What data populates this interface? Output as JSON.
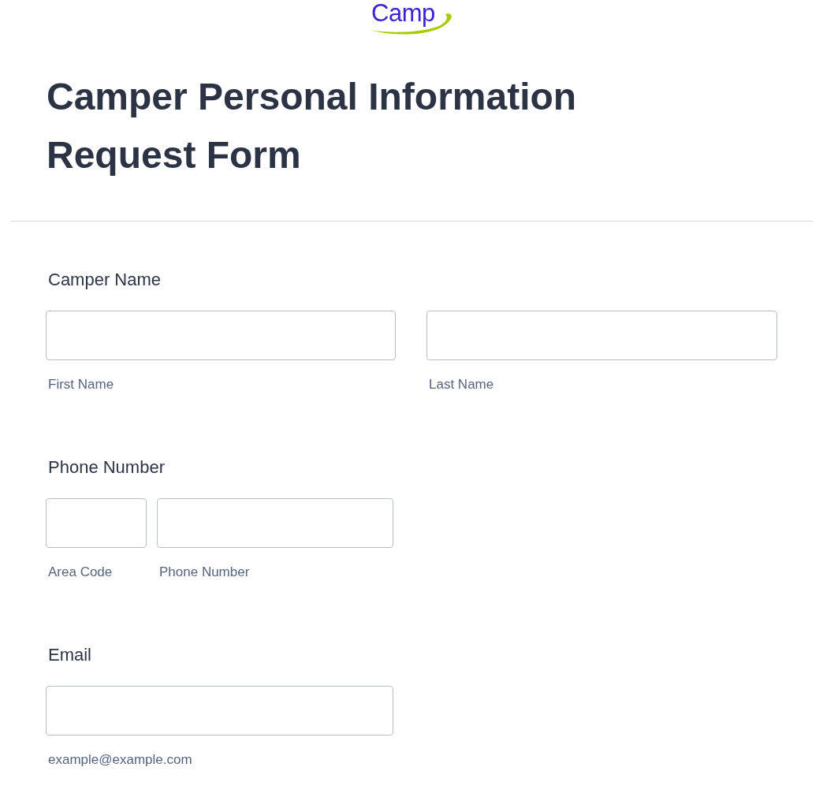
{
  "logo": {
    "text": "Camp"
  },
  "title": "Camper Personal Information Request Form",
  "fields": [
    {
      "kind": "name",
      "label": "Camper Name",
      "inputs": [
        {
          "sublabel": "First Name"
        },
        {
          "sublabel": "Last Name"
        }
      ]
    },
    {
      "kind": "phone",
      "label": "Phone Number",
      "inputs": [
        {
          "sublabel": "Area Code"
        },
        {
          "sublabel": "Phone Number"
        }
      ]
    },
    {
      "kind": "email",
      "label": "Email",
      "inputs": [
        {
          "sublabel": "example@example.com"
        }
      ]
    }
  ]
}
